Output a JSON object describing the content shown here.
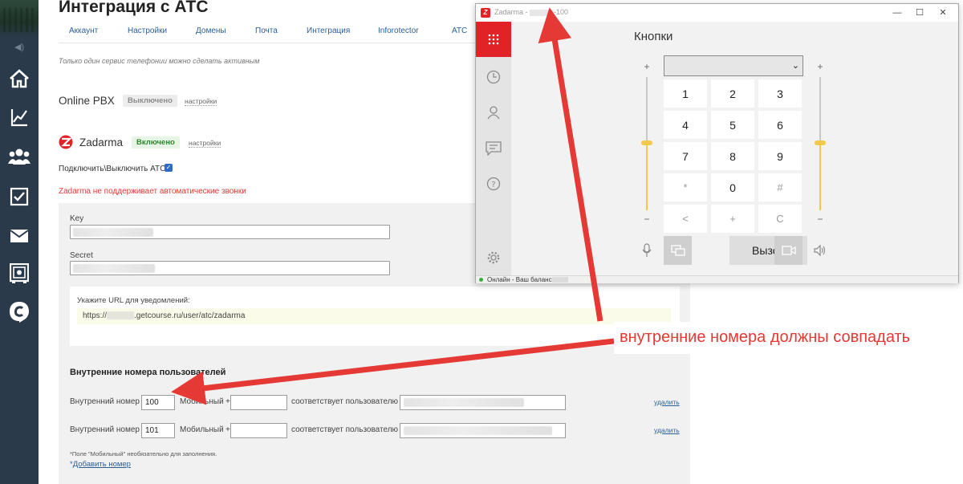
{
  "page": {
    "title": "Интеграция с АТС",
    "hint": "Только один сервис телефонии можно сделать активным"
  },
  "tabs": [
    "Аккаунт",
    "Настройки",
    "Домены",
    "Почта",
    "Интеграция",
    "Inforotector",
    "АТС"
  ],
  "services": {
    "online_pbx": {
      "name": "Online PBX",
      "status": "Выключено",
      "settings": "настройки"
    },
    "zadarma": {
      "name": "Zadarma",
      "status": "Включено",
      "settings": "настройки"
    }
  },
  "pbx_toggle": {
    "label": "Подключить\\Выключить АТС",
    "checked": true
  },
  "warning": "Zadarma не поддерживает автоматические звонки",
  "form": {
    "key_label": "Key",
    "secret_label": "Secret",
    "url_label": "Укажите URL для уведомлений:",
    "url_prefix": "https://",
    "url_suffix": ".getcourse.ru/user/atc/zadarma"
  },
  "extensions": {
    "heading": "Внутренние номера пользователей",
    "ext_label": "Внутренний номер",
    "mobile_label": "Мобильный",
    "plus": "+",
    "matches_label": "соответствует пользователю",
    "delete_label": "удалить",
    "rows": [
      {
        "ext": "100",
        "mobile": ""
      },
      {
        "ext": "101",
        "mobile": ""
      }
    ],
    "note": "*Поле \"Мобильный\" необязательно для заполнения.",
    "add_prefix": "*",
    "add_link": "Добавить номер"
  },
  "zadarma_window": {
    "logo_letter": "Z",
    "title_prefix": "Zadarma - ",
    "title_suffix": "-100",
    "minimize": "—",
    "maximize": "☐",
    "close": "✕",
    "heading": "Кнопки",
    "select_value": "",
    "chevron": "⌄",
    "keys": [
      "1",
      "2",
      "3",
      "4",
      "5",
      "6",
      "7",
      "8",
      "9",
      "*",
      "0",
      "#",
      "<",
      "+",
      "C"
    ],
    "vol_plus": "+",
    "vol_minus": "−",
    "call_label": "Вызов",
    "status": "Онлайн - Ваш баланс",
    "colors": {
      "accent": "#e12328",
      "slider": "#f2c94c",
      "online": "#34b233"
    }
  },
  "annotation": {
    "text": "внутренние номера должны совпадать",
    "color": "#e53935"
  }
}
